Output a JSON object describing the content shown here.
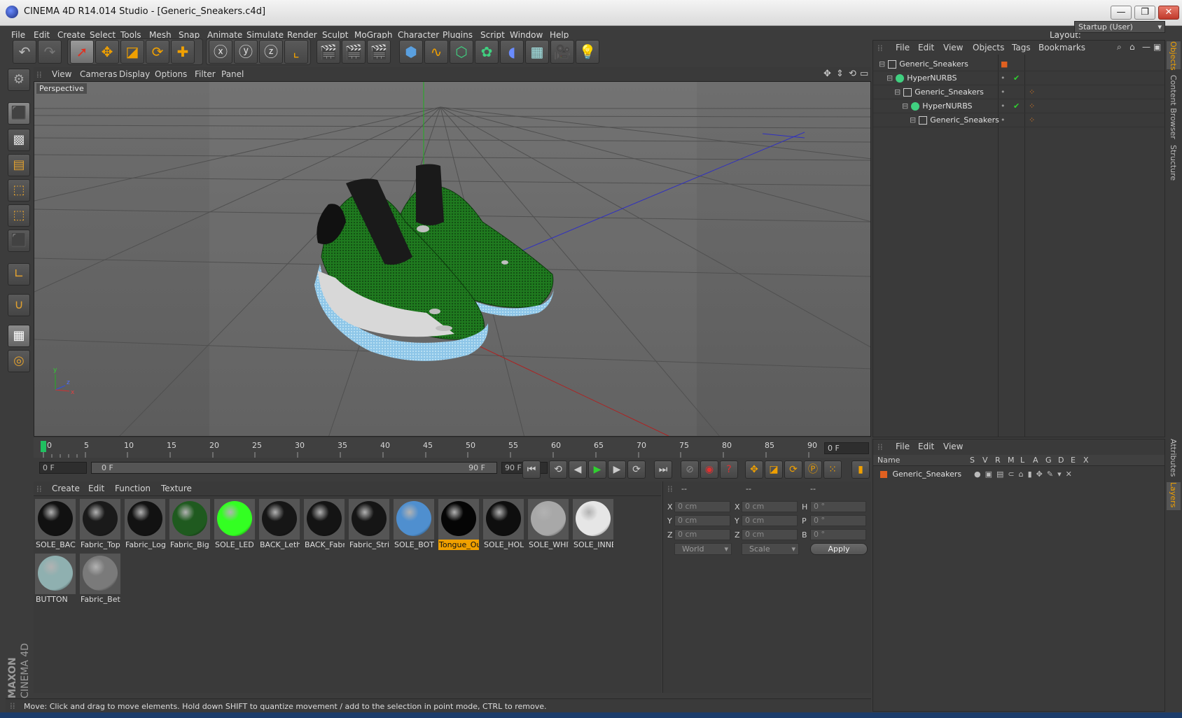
{
  "window": {
    "title": "CINEMA 4D R14.014 Studio - [Generic_Sneakers.c4d]",
    "minimize": "—",
    "maximize": "❐",
    "close": "✕"
  },
  "menubar": {
    "items": [
      "File",
      "Edit",
      "Create",
      "Select",
      "Tools",
      "Mesh",
      "Snap",
      "Animate",
      "Simulate",
      "Render",
      "Sculpt",
      "MoGraph",
      "Character",
      "Plugins",
      "Script",
      "Window",
      "Help"
    ],
    "layout_label": "Layout:",
    "layout_value": "Startup (User)"
  },
  "viewport": {
    "menu": [
      "View",
      "Cameras",
      "Display",
      "Options",
      "Filter",
      "Panel"
    ],
    "label": "Perspective",
    "axis_y": "y",
    "axis_z": "z",
    "axis_x": "x"
  },
  "timeline": {
    "ticks": [
      "0",
      "5",
      "10",
      "15",
      "20",
      "25",
      "30",
      "35",
      "40",
      "45",
      "50",
      "55",
      "60",
      "65",
      "70",
      "75",
      "80",
      "85",
      "90"
    ],
    "current_frame": "0 F",
    "start_field": "0 F",
    "range_start": "0 F",
    "range_end": "90 F",
    "end_field": "90 F"
  },
  "materials": {
    "menu": [
      "Create",
      "Edit",
      "Function",
      "Texture"
    ],
    "items": [
      {
        "label": "SOLE_BACK",
        "color": "#111111",
        "highlight": false
      },
      {
        "label": "Fabric_Top",
        "color": "#1a1a1a",
        "highlight": false
      },
      {
        "label": "Fabric_Log",
        "color": "#121212",
        "highlight": false
      },
      {
        "label": "Fabric_Big",
        "color": "#1f5a1f",
        "highlight": false
      },
      {
        "label": "SOLE_LED",
        "color": "#33ff22",
        "highlight": false
      },
      {
        "label": "BACK_Leth",
        "color": "#161616",
        "highlight": false
      },
      {
        "label": "BACK_Fabr",
        "color": "#141414",
        "highlight": false
      },
      {
        "label": "Fabric_Strip",
        "color": "#151515",
        "highlight": false
      },
      {
        "label": "SOLE_BOTT",
        "color": "#4f8fcf",
        "highlight": false
      },
      {
        "label": "Tongue_Out",
        "color": "#050505",
        "highlight": true
      },
      {
        "label": "SOLE_HOLE",
        "color": "#0e0e0e",
        "highlight": false
      },
      {
        "label": "SOLE_WHITE",
        "color": "#a8a8a8",
        "highlight": false
      },
      {
        "label": "SOLE_INNER",
        "color": "#e6e6e6",
        "highlight": false
      },
      {
        "label": "BUTTON",
        "color": "#8fb0b0",
        "highlight": false
      },
      {
        "label": "Fabric_Betw",
        "color": "#7a7a7a",
        "highlight": false
      }
    ]
  },
  "coordinates": {
    "headers": [
      "--",
      "--",
      "--"
    ],
    "rows": [
      {
        "a": "X",
        "av": "0 cm",
        "b": "X",
        "bv": "0 cm",
        "c": "H",
        "cv": "0 °"
      },
      {
        "a": "Y",
        "av": "0 cm",
        "b": "Y",
        "bv": "0 cm",
        "c": "P",
        "cv": "0 °"
      },
      {
        "a": "Z",
        "av": "0 cm",
        "b": "Z",
        "bv": "0 cm",
        "c": "B",
        "cv": "0 °"
      }
    ],
    "mode": "World",
    "scale": "Scale",
    "apply": "Apply"
  },
  "objects_panel": {
    "menu": [
      "File",
      "Edit",
      "View",
      "Objects",
      "Tags",
      "Bookmarks"
    ],
    "tree": [
      {
        "label": "Generic_Sneakers",
        "depth": 0,
        "type": "null"
      },
      {
        "label": "HyperNURBS",
        "depth": 1,
        "type": "nurbs"
      },
      {
        "label": "Generic_Sneakers",
        "depth": 2,
        "type": "null"
      },
      {
        "label": "HyperNURBS",
        "depth": 3,
        "type": "nurbs"
      },
      {
        "label": "Generic_Sneakers",
        "depth": 4,
        "type": "null"
      }
    ]
  },
  "layers_panel": {
    "menu": [
      "File",
      "Edit",
      "View"
    ],
    "name_header": "Name",
    "columns": [
      "S",
      "V",
      "R",
      "M",
      "L",
      "A",
      "G",
      "D",
      "E",
      "X"
    ],
    "rows": [
      {
        "label": "Generic_Sneakers",
        "color": "#e06020"
      }
    ]
  },
  "right_tabs": {
    "objects": "Objects",
    "content_browser": "Content Browser",
    "structure": "Structure",
    "attributes": "Attributes",
    "layers": "Layers"
  },
  "logo": {
    "maxon": "MAXON",
    "c4d": "CINEMA 4D"
  },
  "status": {
    "text": "Move: Click and drag to move elements. Hold down SHIFT to quantize movement / add to the selection in point mode, CTRL to remove."
  },
  "colors": {
    "accent": "#f0a000",
    "background": "#3c3c3c",
    "shoe_green": "#1f7a1f"
  }
}
